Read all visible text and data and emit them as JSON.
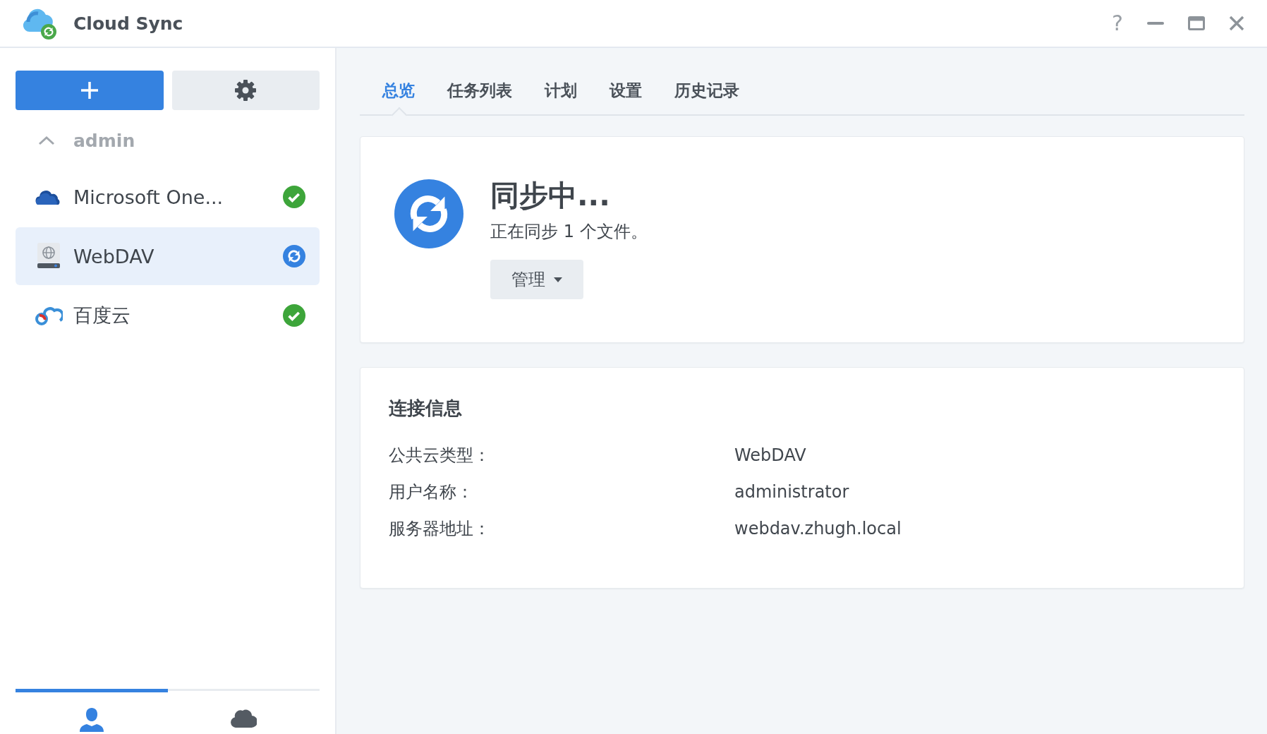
{
  "window": {
    "title": "Cloud Sync",
    "help": "?"
  },
  "sidebar": {
    "account": {
      "name": "admin",
      "expanded": true
    },
    "items": [
      {
        "name": "Microsoft One...",
        "kind": "onedrive",
        "status": {
          "kind": "done"
        },
        "selected": false
      },
      {
        "name": "WebDAV",
        "kind": "webdav",
        "status": {
          "kind": "syncing"
        },
        "selected": true
      },
      {
        "name": "百度云",
        "kind": "baidu",
        "status": {
          "kind": "done"
        },
        "selected": false
      }
    ],
    "bottom_tabs": [
      {
        "kind": "user",
        "selected": true
      },
      {
        "kind": "cloud",
        "selected": false
      }
    ]
  },
  "tabs": [
    {
      "label": "总览",
      "selected": true
    },
    {
      "label": "任务列表",
      "selected": false
    },
    {
      "label": "计划",
      "selected": false
    },
    {
      "label": "设置",
      "selected": false
    },
    {
      "label": "历史记录",
      "selected": false
    }
  ],
  "status": {
    "icon": {
      "kind": "syncing"
    },
    "title": "同步中...",
    "message": "正在同步 1 个文件。",
    "button": "管理"
  },
  "connection": {
    "heading": "连接信息",
    "rows": [
      {
        "label": "公共云类型：",
        "value": "WebDAV"
      },
      {
        "label": "用户名称：",
        "value": "administrator"
      },
      {
        "label": "服务器地址：",
        "value": "webdav.zhugh.local"
      }
    ]
  }
}
